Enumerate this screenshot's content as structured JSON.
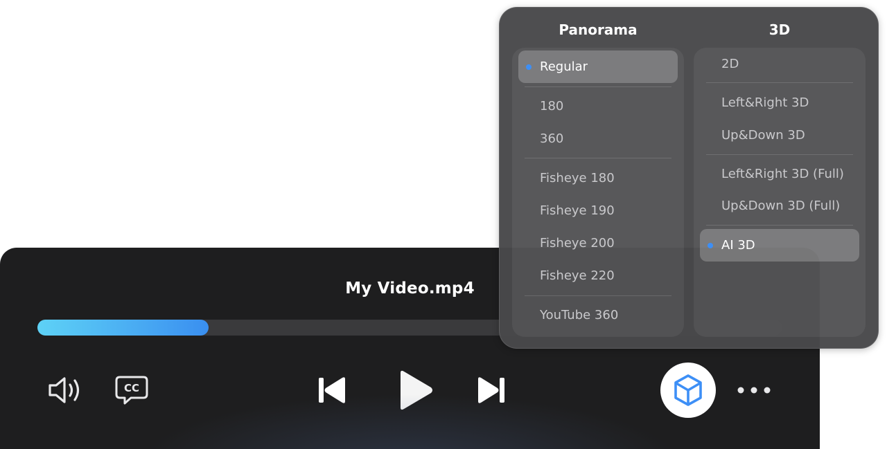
{
  "player": {
    "video_title": "My Video.mp4",
    "progress_percent": 23,
    "accent_gradient": [
      "#5ed2f6",
      "#3a8ff0"
    ],
    "controls": {
      "volume_icon": "speaker-icon",
      "captions_icon": "cc-icon",
      "captions_label": "CC",
      "previous_icon": "skip-previous-icon",
      "play_icon": "play-icon",
      "next_icon": "skip-next-icon",
      "threed_icon": "cube-icon",
      "more_icon": "more-dots-icon"
    }
  },
  "menu": {
    "panorama": {
      "header": "Panorama",
      "items": [
        {
          "label": "Regular",
          "selected": true
        },
        {
          "label": "180",
          "selected": false
        },
        {
          "label": "360",
          "selected": false
        },
        {
          "label": "Fisheye 180",
          "selected": false
        },
        {
          "label": "Fisheye 190",
          "selected": false
        },
        {
          "label": "Fisheye 200",
          "selected": false
        },
        {
          "label": "Fisheye 220",
          "selected": false
        },
        {
          "label": "YouTube 360",
          "selected": false
        }
      ]
    },
    "three_d": {
      "header": "3D",
      "items": [
        {
          "label": "2D",
          "selected": false
        },
        {
          "label": "Left&Right 3D",
          "selected": false
        },
        {
          "label": "Up&Down 3D",
          "selected": false
        },
        {
          "label": "Left&Right 3D (Full)",
          "selected": false
        },
        {
          "label": "Up&Down 3D (Full)",
          "selected": false
        },
        {
          "label": "AI 3D",
          "selected": true
        }
      ]
    },
    "selection_color": "#3d8ff6"
  }
}
